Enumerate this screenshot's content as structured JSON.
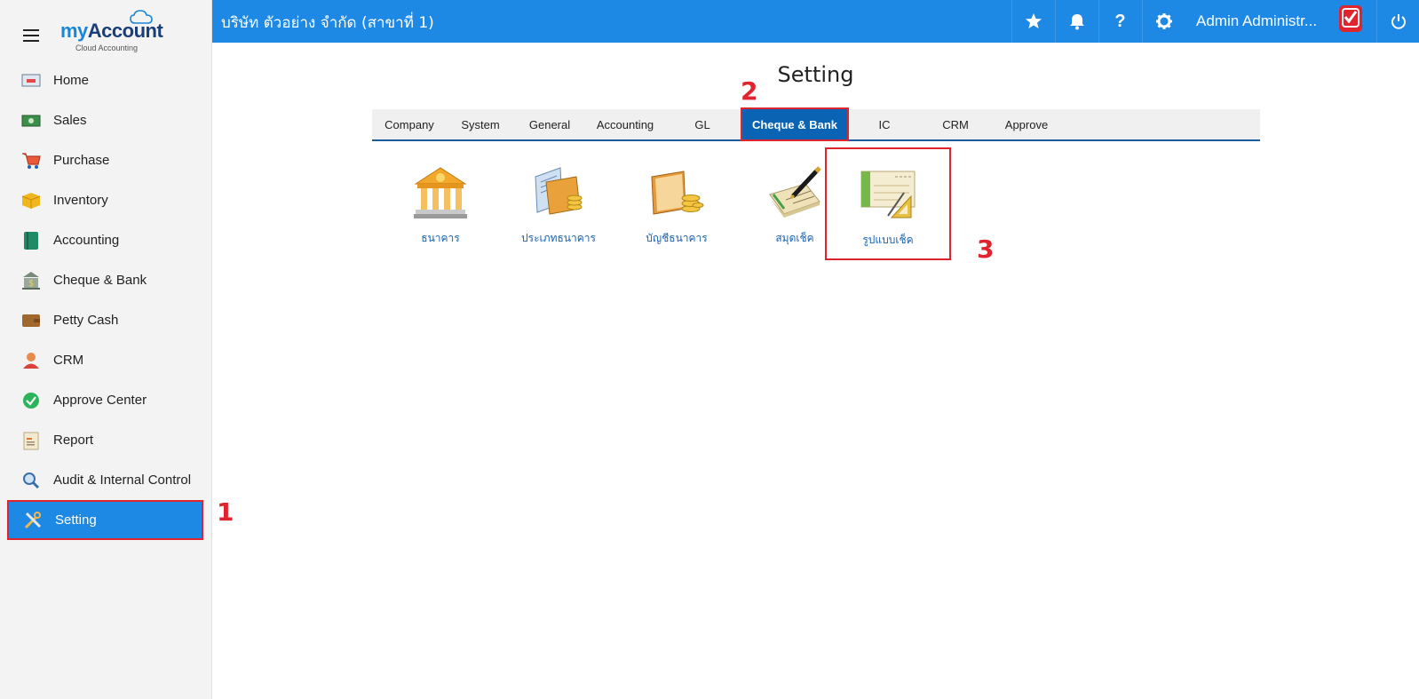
{
  "brand": {
    "name_my": "my",
    "name_account": "Account",
    "tagline": "Cloud Accounting"
  },
  "sidebar": {
    "items": [
      {
        "label": "Home",
        "icon": "home-icon"
      },
      {
        "label": "Sales",
        "icon": "sales-icon"
      },
      {
        "label": "Purchase",
        "icon": "cart-icon"
      },
      {
        "label": "Inventory",
        "icon": "box-icon"
      },
      {
        "label": "Accounting",
        "icon": "book-icon"
      },
      {
        "label": "Cheque & Bank",
        "icon": "bank-icon"
      },
      {
        "label": "Petty Cash",
        "icon": "wallet-icon"
      },
      {
        "label": "CRM",
        "icon": "people-icon"
      },
      {
        "label": "Approve Center",
        "icon": "check-circle-icon"
      },
      {
        "label": "Report",
        "icon": "report-icon"
      },
      {
        "label": "Audit & Internal Control",
        "icon": "magnifier-icon"
      },
      {
        "label": "Setting",
        "icon": "tools-icon",
        "active": true
      }
    ]
  },
  "header": {
    "company": "บริษัท ตัวอย่าง จำกัด (สาขาที่ 1)",
    "user": "Admin Administr...",
    "icons": [
      "star-icon",
      "bell-icon",
      "help-icon",
      "gear-icon",
      "power-icon"
    ]
  },
  "main": {
    "title": "Setting",
    "tabs": [
      {
        "label": "Company"
      },
      {
        "label": "System"
      },
      {
        "label": "General"
      },
      {
        "label": "Accounting"
      },
      {
        "label": "GL"
      },
      {
        "label": "Cheque & Bank",
        "active": true
      },
      {
        "label": "IC"
      },
      {
        "label": "CRM"
      },
      {
        "label": "Approve"
      }
    ],
    "tiles": [
      {
        "label": "ธนาคาร",
        "icon": "bank-building-icon"
      },
      {
        "label": "ประเภทธนาคาร",
        "icon": "bank-type-icon"
      },
      {
        "label": "บัญชีธนาคาร",
        "icon": "bank-account-icon"
      },
      {
        "label": "สมุดเช็ค",
        "icon": "chequebook-icon"
      },
      {
        "label": "รูปแบบเช็ค",
        "icon": "cheque-format-icon"
      }
    ]
  },
  "annotations": {
    "step1": "1",
    "step2": "2",
    "step3": "3"
  },
  "colors": {
    "primary": "#1e88e5",
    "tab_active": "#0b63b3",
    "highlight": "#e0242e",
    "link": "#1b63b0"
  }
}
